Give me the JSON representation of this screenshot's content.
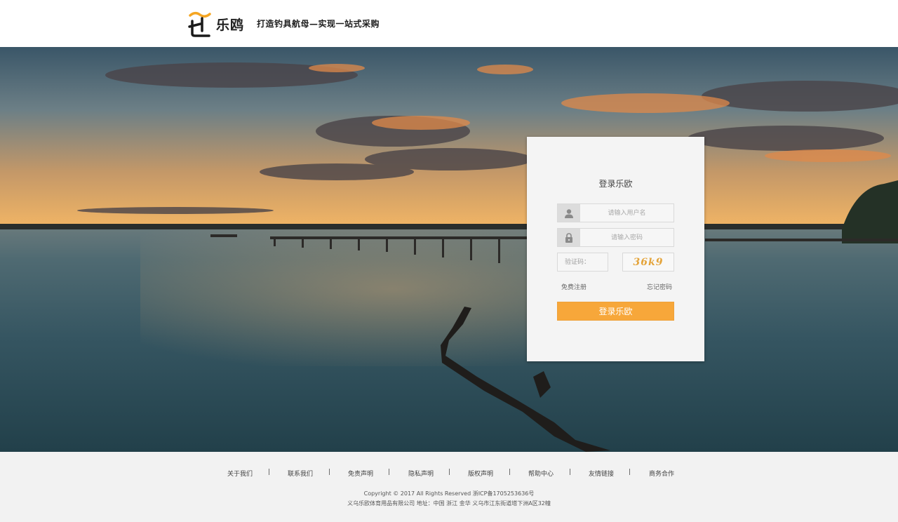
{
  "header": {
    "logo_text": "乐鸥",
    "slogan": "打造钓具航母—实现一站式采购"
  },
  "login": {
    "title": "登录乐欧",
    "username_placeholder": "请输入用户名",
    "password_placeholder": "请输入密码",
    "captcha_placeholder": "验证码：",
    "captcha_text": "36k9",
    "register_link": "免费注册",
    "forgot_link": "忘记密码",
    "submit_label": "登录乐欧"
  },
  "footer": {
    "nav": [
      "关于我们",
      "联系我们",
      "免责声明",
      "隐私声明",
      "版权声明",
      "帮助中心",
      "友情链接",
      "商务合作"
    ],
    "separator": "|",
    "copyright": "Copyright © 2017 All Rights Reserved 浙ICP备1705253636号",
    "address": "义乌乐欧体育用品有限公司    地址：中国 浙江 金华 义乌市江东街道塔下洲A区32幢"
  },
  "colors": {
    "accent": "#f7a73a",
    "logo_accent": "#f5a623"
  }
}
